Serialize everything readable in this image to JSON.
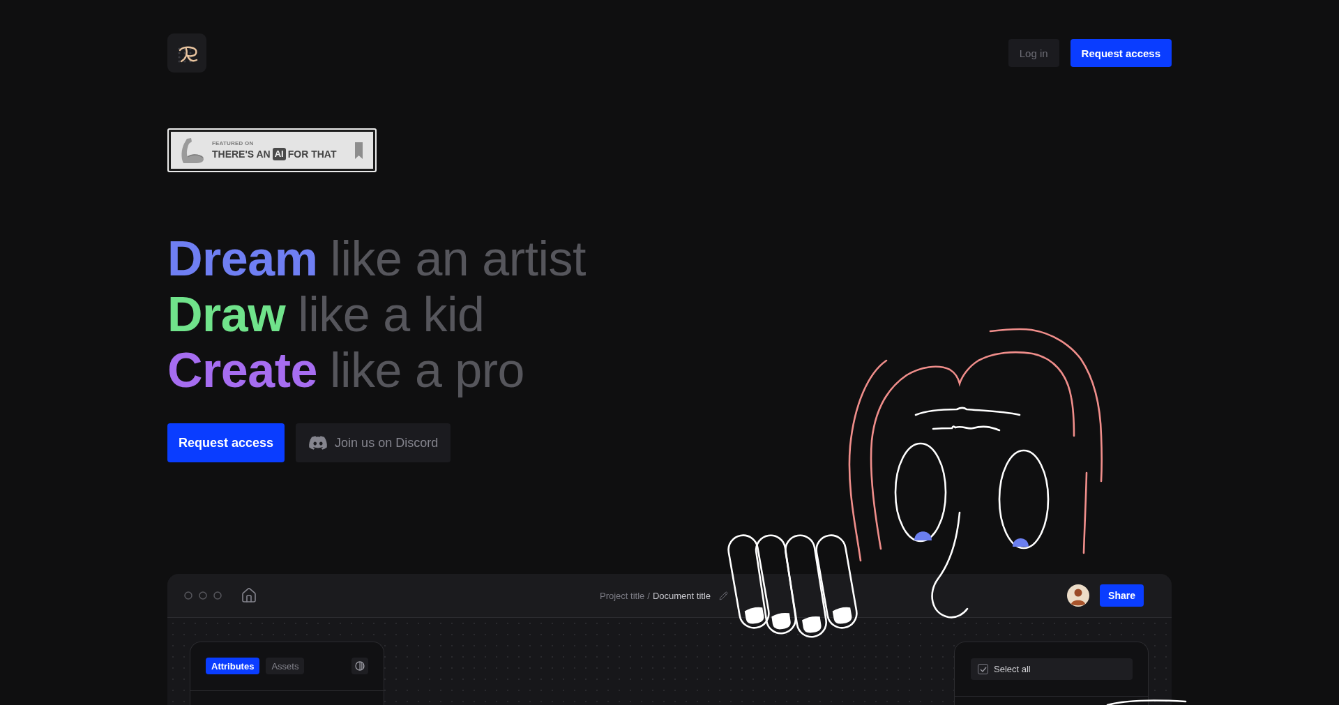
{
  "nav": {
    "buttons": [
      {
        "kind": "secondary",
        "label": "Log in"
      },
      {
        "kind": "primary",
        "label": "Request access"
      }
    ]
  },
  "badge": {
    "eyebrow": "FEATURED ON",
    "before": "THERE'S AN",
    "highlight": "AI",
    "after": "FOR THAT"
  },
  "headline": [
    {
      "word": "Dream",
      "rest": "like an artist",
      "color": "#6f7ff3"
    },
    {
      "word": "Draw",
      "rest": "like a kid",
      "color": "#70e38b"
    },
    {
      "word": "Create",
      "rest": "like a pro",
      "color": "#a66df1"
    }
  ],
  "actions": [
    {
      "kind": "primary",
      "label": "Request access"
    },
    {
      "kind": "discord",
      "label": "Join us on Discord"
    }
  ],
  "app": {
    "breadcrumb": {
      "project": "Project title",
      "separator": "/",
      "document": "Document title"
    },
    "share": "Share",
    "panel_tabs": [
      {
        "label": "Attributes",
        "selected": true
      },
      {
        "label": "Assets",
        "selected": false
      }
    ],
    "select_all": {
      "label": "Select all",
      "checked": true
    }
  }
}
